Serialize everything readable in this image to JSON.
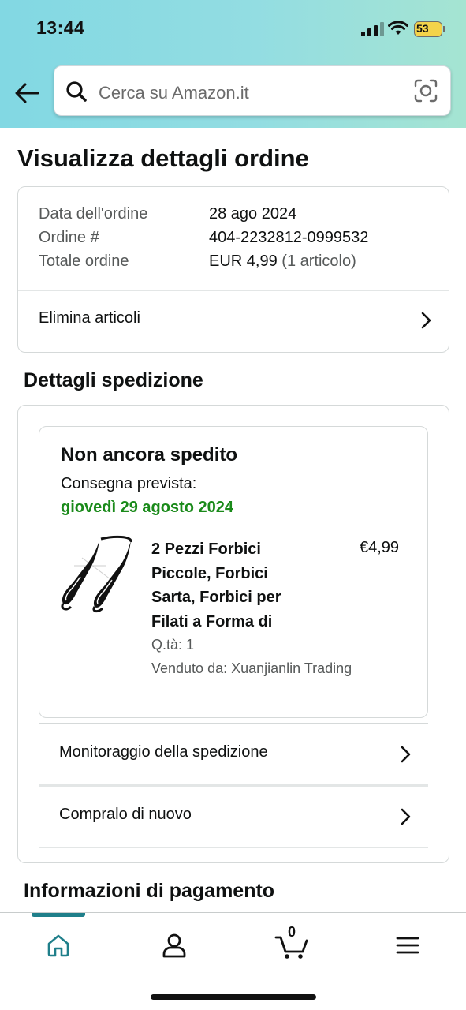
{
  "status_bar": {
    "time": "13:44",
    "battery": "53"
  },
  "header": {
    "search_placeholder": "Cerca su Amazon.it",
    "back_icon": "arrow-left-icon",
    "search_icon": "magnifier-icon",
    "camera_icon": "camera-scan-icon"
  },
  "page": {
    "title": "Visualizza dettagli ordine"
  },
  "order_summary": {
    "date_label": "Data dell'ordine",
    "date_value": "28 ago 2024",
    "number_label": "Ordine #",
    "number_value": "404-2232812-0999532",
    "total_label": "Totale ordine",
    "total_value": "EUR 4,99",
    "total_items": "(1 articolo)",
    "remove_items_label": "Elimina articoli"
  },
  "shipment": {
    "section_title": "Dettagli spedizione",
    "status": "Non ancora spedito",
    "delivery_label": "Consegna prevista:",
    "delivery_date": "giovedì 29 agosto 2024",
    "product": {
      "title_lines": [
        "2 Pezzi Forbici",
        "Piccole, Forbici",
        "Sarta, Forbici per",
        "Filati a Forma di"
      ],
      "price": "€4,99",
      "quantity": "Q.tà: 1",
      "seller": "Venduto da: Xuanjianlin Trading"
    },
    "track_label": "Monitoraggio della spedizione",
    "buy_again_label": "Compralo di nuovo"
  },
  "payment": {
    "section_title": "Informazioni di pagamento"
  },
  "bottom_nav": {
    "cart_count": "0",
    "items": [
      "home-icon",
      "account-icon",
      "cart-icon",
      "menu-icon"
    ]
  },
  "colors": {
    "header_gradient_start": "#82d8e3",
    "header_gradient_end": "#a5e4d2",
    "delivery_green": "#1a8a1a",
    "nav_active": "#1f7f8a",
    "battery": "#f3d34a"
  }
}
